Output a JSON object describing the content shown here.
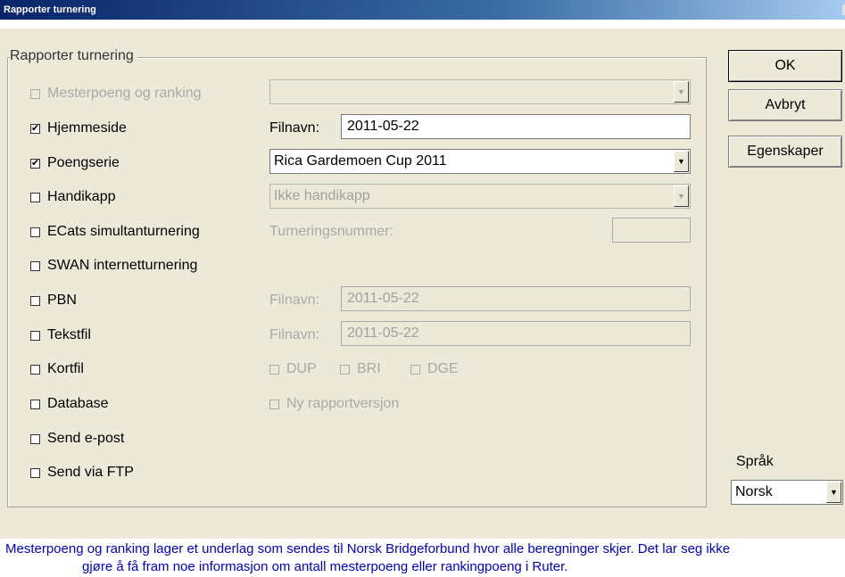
{
  "window": {
    "title": "Rapporter turnering"
  },
  "group": {
    "legend": "Rapporter turnering"
  },
  "options": [
    {
      "label": "Mesterpoeng og ranking",
      "checked": false,
      "enabled": false
    },
    {
      "label": "Hjemmeside",
      "checked": true,
      "enabled": true
    },
    {
      "label": "Poengserie",
      "checked": true,
      "enabled": true
    },
    {
      "label": "Handikapp",
      "checked": false,
      "enabled": true
    },
    {
      "label": "ECats simultanturnering",
      "checked": false,
      "enabled": true
    },
    {
      "label": "SWAN internetturnering",
      "checked": false,
      "enabled": true
    },
    {
      "label": "PBN",
      "checked": false,
      "enabled": true
    },
    {
      "label": "Tekstfil",
      "checked": false,
      "enabled": true
    },
    {
      "label": "Kortfil",
      "checked": false,
      "enabled": true
    },
    {
      "label": "Database",
      "checked": false,
      "enabled": true
    },
    {
      "label": "Send e-post",
      "checked": false,
      "enabled": true
    },
    {
      "label": "Send via FTP",
      "checked": false,
      "enabled": true
    }
  ],
  "mesterpoeng_select": {
    "value": ""
  },
  "hjemmeside": {
    "label": "Filnavn:",
    "value": "2011-05-22"
  },
  "poengserie_select": {
    "value": "Rica Gardemoen Cup 2011"
  },
  "handikapp_select": {
    "value": "Ikke handikapp"
  },
  "ecats": {
    "label": "Turneringsnummer:",
    "value": ""
  },
  "pbn": {
    "label": "Filnavn:",
    "value": "2011-05-22"
  },
  "tekstfil": {
    "label": "Filnavn:",
    "value": "2011-05-22"
  },
  "kortfil_formats": [
    {
      "label": "DUP",
      "checked": false
    },
    {
      "label": "BRI",
      "checked": false
    },
    {
      "label": "DGE",
      "checked": false
    }
  ],
  "database": {
    "ny_rapportversjon": "Ny rapportversjon",
    "checked": false
  },
  "buttons": {
    "ok": "OK",
    "cancel": "Avbryt",
    "properties": "Egenskaper"
  },
  "language": {
    "label": "Språk",
    "value": "Norsk"
  },
  "info": {
    "line1": "Mesterpoeng og ranking lager et underlag som sendes til Norsk Bridgeforbund hvor alle beregninger skjer. Det lar seg ikke",
    "line2": "gjøre å få fram noe informasjon om antall mesterpoeng eller rankingpoeng i Ruter."
  }
}
